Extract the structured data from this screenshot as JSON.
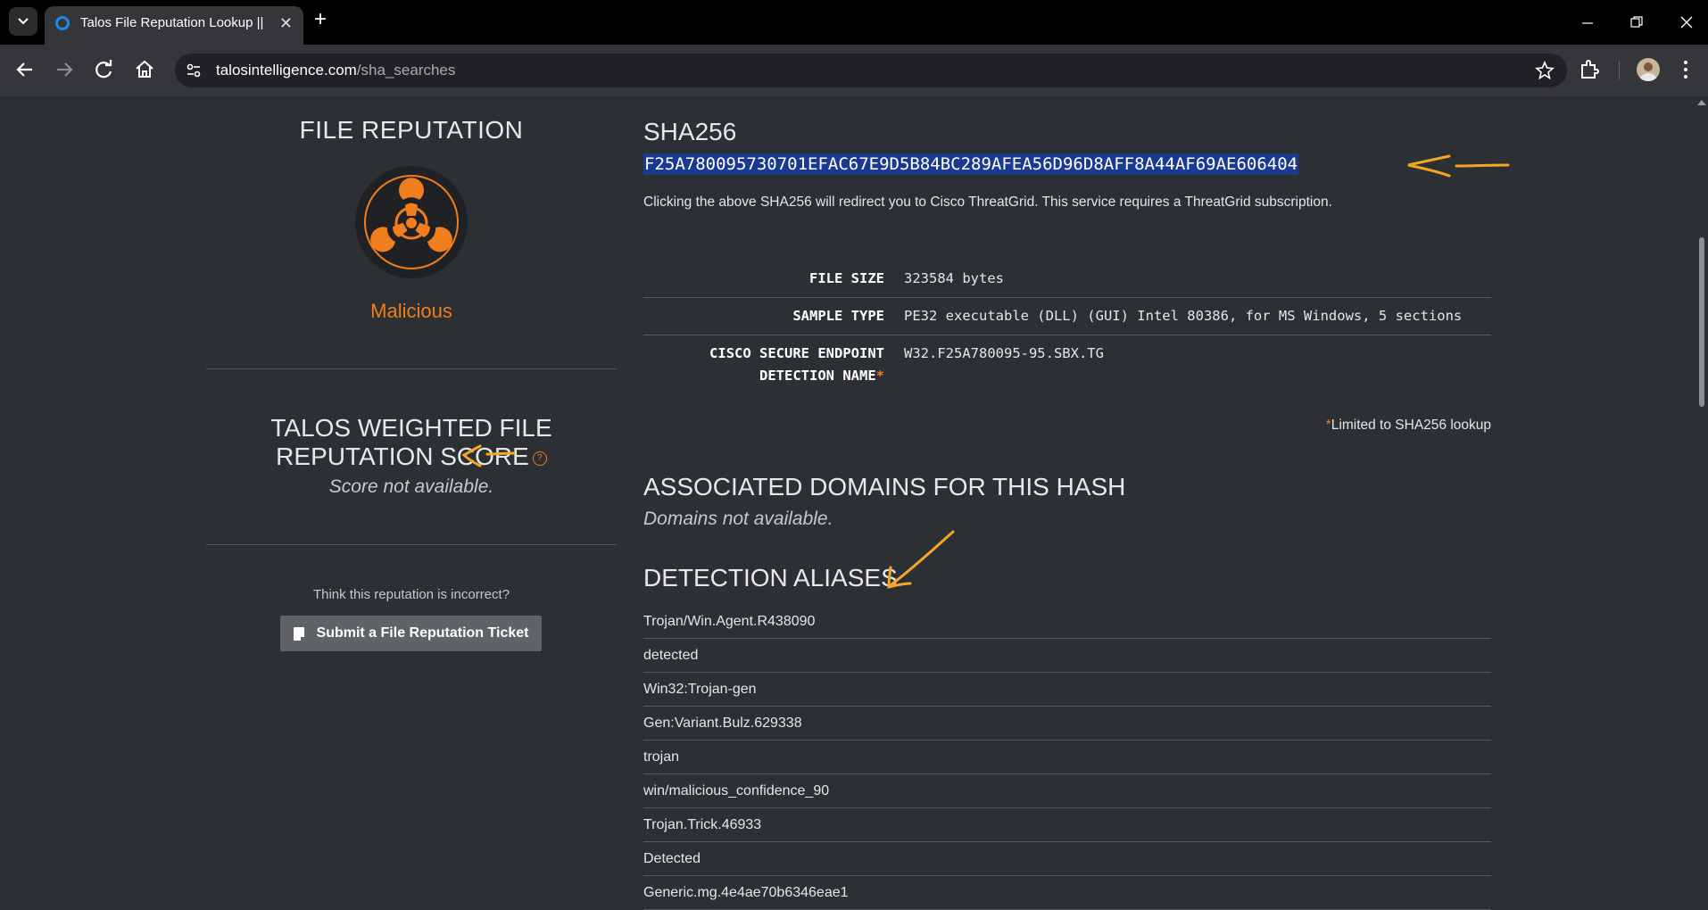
{
  "browser": {
    "tab_title": "Talos File Reputation Lookup || Cisco Talos",
    "url_host": "talosintelligence.com",
    "url_path": "/sha_searches",
    "new_tab_label": "+",
    "close_tab_label": "✕"
  },
  "left_panel": {
    "title": "FILE REPUTATION",
    "verdict": "Malicious",
    "score_title": "TALOS WEIGHTED FILE REPUTATION SCORE",
    "score_value": "Score not available.",
    "incorrect_prompt": "Think this reputation is incorrect?",
    "ticket_button": "Submit a File Reputation Ticket"
  },
  "right_panel": {
    "sha_label": "SHA256",
    "sha_value": "F25A780095730701EFAC67E9D5B84BC289AFEA56D96D8AFF8A44AF69AE606404",
    "sha_note": "Clicking the above SHA256 will redirect you to Cisco ThreatGrid. This service requires a ThreatGrid subscription.",
    "details": [
      {
        "key": "FILE SIZE",
        "value": "323584 bytes"
      },
      {
        "key": "SAMPLE TYPE",
        "value": "PE32 executable (DLL) (GUI) Intel 80386, for MS Windows, 5 sections"
      },
      {
        "key": "CISCO SECURE ENDPOINT DETECTION NAME",
        "value": "W32.F25A780095-95.SBX.TG"
      }
    ],
    "asterisk": "*",
    "limited_note": "Limited to SHA256 lookup",
    "domains_title": "ASSOCIATED DOMAINS FOR THIS HASH",
    "domains_value": "Domains not available.",
    "aliases_title": "DETECTION ALIASES",
    "aliases": [
      "Trojan/Win.Agent.R438090",
      "detected",
      "Win32:Trojan-gen",
      "Gen:Variant.Bulz.629338",
      "trojan",
      "win/malicious_confidence_90",
      "Trojan.Trick.46933",
      "Detected",
      "Generic.mg.4e4ae70b6346eae1"
    ]
  },
  "colors": {
    "accent": "#f07d1e",
    "background": "#2c2f34",
    "selection": "#1a3a8f",
    "annotation": "#f5a623"
  }
}
